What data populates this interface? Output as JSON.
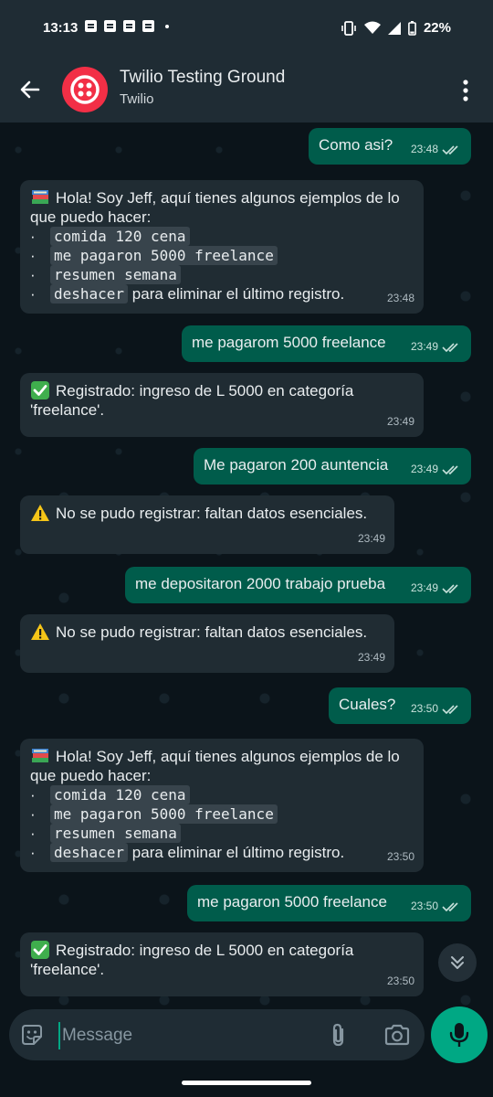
{
  "status_bar": {
    "time": "13:13",
    "battery": "22%"
  },
  "header": {
    "title": "Twilio Testing Ground",
    "subtitle": "Twilio"
  },
  "messages": [
    {
      "text": "Como asi?",
      "time": "23:48"
    },
    {
      "intro": "Hola! Soy Jeff, aquí tienes algunos ejemplos de lo que puedo hacer:",
      "bullet": "·",
      "cmds": [
        "comida 120 cena",
        "me pagaron 5000 freelance",
        "resumen semana",
        "deshacer"
      ],
      "suffix": "para eliminar el último registro.",
      "time": "23:48"
    },
    {
      "text": "me pagarom 5000 freelance",
      "time": "23:49"
    },
    {
      "text": "Registrado: ingreso de L 5000 en categoría 'freelance'.",
      "time": "23:49"
    },
    {
      "text": "Me pagaron 200 auntencia",
      "time": "23:49"
    },
    {
      "text": "No se pudo registrar: faltan datos esenciales.",
      "time": "23:49"
    },
    {
      "text": "me depositaron 2000 trabajo prueba",
      "time": "23:49"
    },
    {
      "text": "No se pudo registrar: faltan datos esenciales.",
      "time": "23:49"
    },
    {
      "text": "Cuales?",
      "time": "23:50"
    },
    {
      "intro": "Hola! Soy Jeff, aquí tienes algunos ejemplos de lo que puedo hacer:",
      "bullet": "·",
      "cmds": [
        "comida 120 cena",
        "me pagaron 5000 freelance",
        "resumen semana",
        "deshacer"
      ],
      "suffix": "para eliminar el último registro.",
      "time": "23:50"
    },
    {
      "text": "me pagaron 5000 freelance",
      "time": "23:50"
    },
    {
      "text": "Registrado: ingreso de L 5000 en categoría 'freelance'.",
      "time": "23:50"
    }
  ],
  "composer": {
    "placeholder": "Message"
  },
  "colors": {
    "outgoing": "#005c4b",
    "incoming": "#202c33",
    "accent": "#00a884",
    "brand": "#f22f46"
  },
  "icons": [
    "back-arrow-icon",
    "twilio-logo-icon",
    "more-vert-icon",
    "books-emoji-icon",
    "check-mark-emoji-icon",
    "warning-emoji-icon",
    "double-check-icon",
    "chevrons-down-icon",
    "sticker-icon",
    "paperclip-icon",
    "camera-icon",
    "microphone-icon"
  ]
}
